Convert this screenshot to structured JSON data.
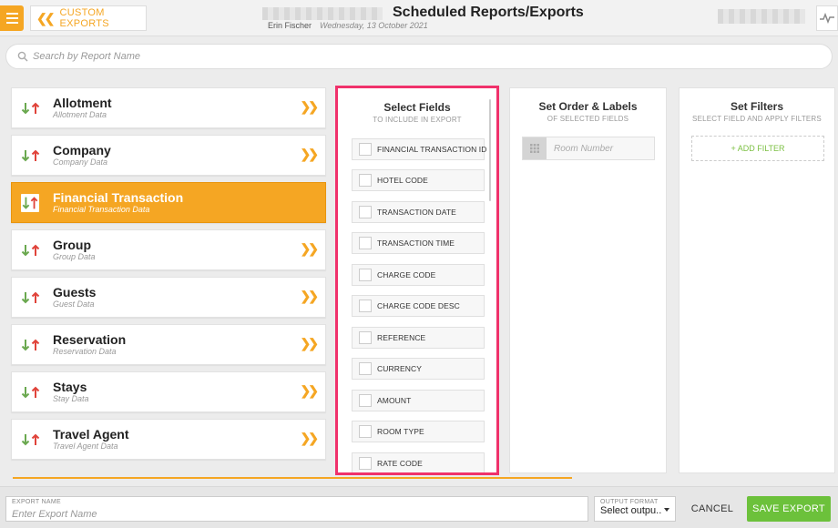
{
  "header": {
    "back_label": "CUSTOM EXPORTS",
    "title": "Scheduled Reports/Exports",
    "user": "Erin Fischer",
    "date": "Wednesday, 13 October 2021"
  },
  "search": {
    "placeholder": "Search by Report Name"
  },
  "categories": [
    {
      "name": "Allotment",
      "sub": "Allotment Data"
    },
    {
      "name": "Company",
      "sub": "Company Data"
    },
    {
      "name": "Financial Transaction",
      "sub": "Financial Transaction Data",
      "active": true
    },
    {
      "name": "Group",
      "sub": "Group Data"
    },
    {
      "name": "Guests",
      "sub": "Guest Data"
    },
    {
      "name": "Reservation",
      "sub": "Reservation Data"
    },
    {
      "name": "Stays",
      "sub": "Stay Data"
    },
    {
      "name": "Travel Agent",
      "sub": "Travel Agent Data"
    }
  ],
  "select_fields": {
    "title": "Select Fields",
    "subtitle": "TO INCLUDE IN EXPORT",
    "fields": [
      "FINANCIAL TRANSACTION ID",
      "HOTEL CODE",
      "TRANSACTION DATE",
      "TRANSACTION TIME",
      "CHARGE CODE",
      "CHARGE CODE DESC",
      "REFERENCE",
      "CURRENCY",
      "AMOUNT",
      "ROOM TYPE",
      "RATE CODE"
    ]
  },
  "order_labels": {
    "title": "Set Order & Labels",
    "subtitle": "OF SELECTED FIELDS",
    "row_placeholder": "Room Number"
  },
  "filters": {
    "title": "Set Filters",
    "subtitle": "SELECT FIELD AND APPLY FILTERS",
    "add_label": "+ ADD FILTER"
  },
  "footer": {
    "export_name_label": "EXPORT NAME",
    "export_name_placeholder": "Enter Export Name",
    "output_format_label": "OUTPUT FORMAT",
    "output_format_value": "Select outpu..",
    "cancel_label": "CANCEL",
    "save_label": "SAVE EXPORT"
  },
  "colors": {
    "accent": "#f5a623",
    "highlight_border": "#f0316b",
    "save_green": "#6cc13b",
    "arrow_down": "#6aa84f",
    "arrow_up": "#e0433a"
  }
}
